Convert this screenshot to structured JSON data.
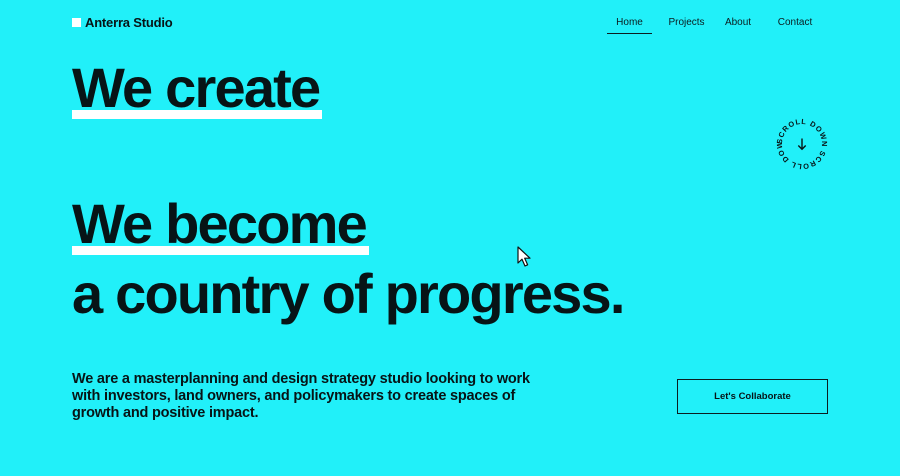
{
  "colors": {
    "background": "#21f0f9",
    "text": "#071416",
    "highlight": "#ffffff"
  },
  "header": {
    "brand_name": "Anterra Studio",
    "nav": [
      {
        "label": "Home",
        "active": true
      },
      {
        "label": "Projects",
        "active": false
      },
      {
        "label": "About",
        "active": false
      },
      {
        "label": "Contact",
        "active": false
      }
    ]
  },
  "hero": {
    "line1": "We create",
    "line2": "We become",
    "line3": "a country of progress."
  },
  "scroll_badge": {
    "text": "SCROLL DOWN SCROLL DOWN ",
    "icon": "arrow-down-icon"
  },
  "description": "We are a masterplanning and design strategy studio looking to work with investors, land owners, and policymakers to create spaces of growth and positive impact.",
  "cta": {
    "label": "Let's Collaborate"
  },
  "icons": {
    "cursor": "mouse-pointer-icon"
  }
}
